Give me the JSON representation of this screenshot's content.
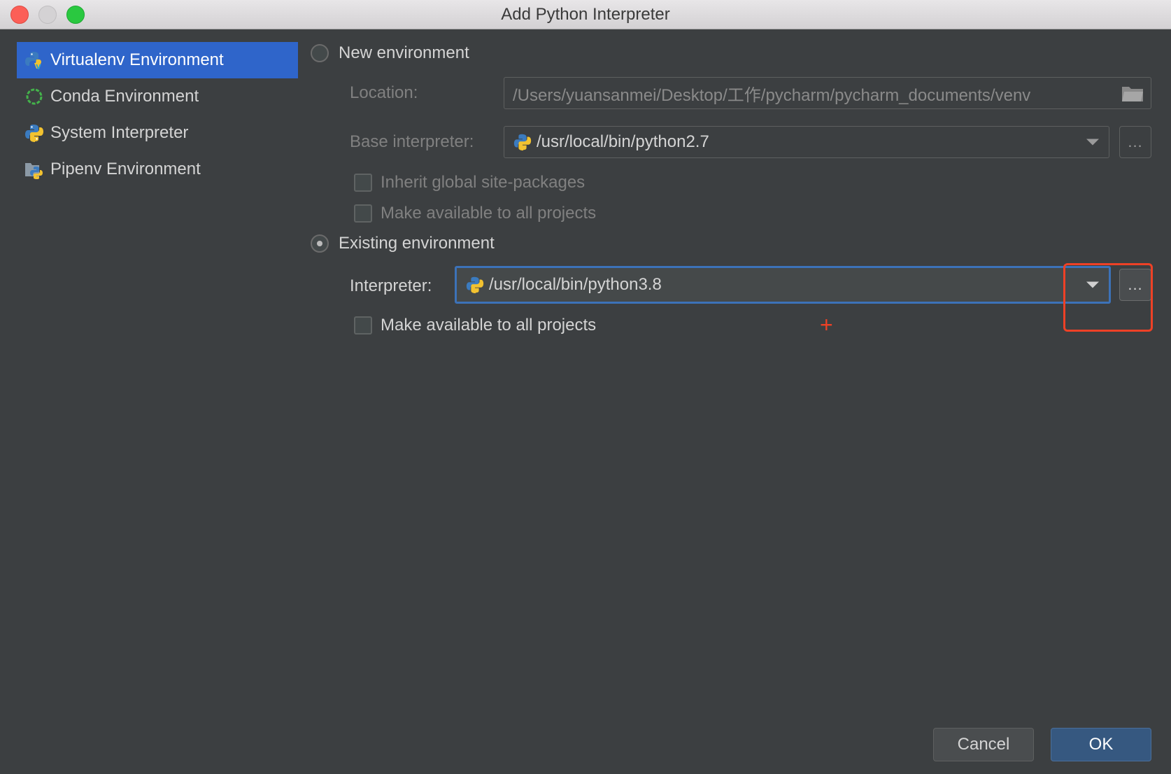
{
  "window": {
    "title": "Add Python Interpreter"
  },
  "sidebar": {
    "items": [
      {
        "label": "Virtualenv Environment",
        "icon": "virtualenv-icon",
        "selected": true
      },
      {
        "label": "Conda Environment",
        "icon": "conda-icon",
        "selected": false
      },
      {
        "label": "System Interpreter",
        "icon": "python-icon",
        "selected": false
      },
      {
        "label": "Pipenv Environment",
        "icon": "pipenv-icon",
        "selected": false
      }
    ]
  },
  "new_env": {
    "radio_label": "New environment",
    "selected": false,
    "location_label": "Location:",
    "location_value": "/Users/yuansanmei/Desktop/工作/pycharm/pycharm_documents/venv",
    "base_interpreter_label": "Base interpreter:",
    "base_interpreter_value": "/usr/local/bin/python2.7",
    "browse_label": "...",
    "inherit_label": "Inherit global site-packages",
    "make_available_label": "Make available to all projects"
  },
  "existing_env": {
    "radio_label": "Existing environment",
    "selected": true,
    "interpreter_label": "Interpreter:",
    "interpreter_value": "/usr/local/bin/python3.8",
    "browse_label": "...",
    "make_available_label": "Make available to all projects"
  },
  "annotation": {
    "cross_symbol": "+",
    "color": "#ee4126"
  },
  "buttons": {
    "cancel": "Cancel",
    "ok": "OK"
  },
  "colors": {
    "selection": "#2f65ca",
    "focus": "#3c72b8",
    "ok_button": "#365880"
  }
}
